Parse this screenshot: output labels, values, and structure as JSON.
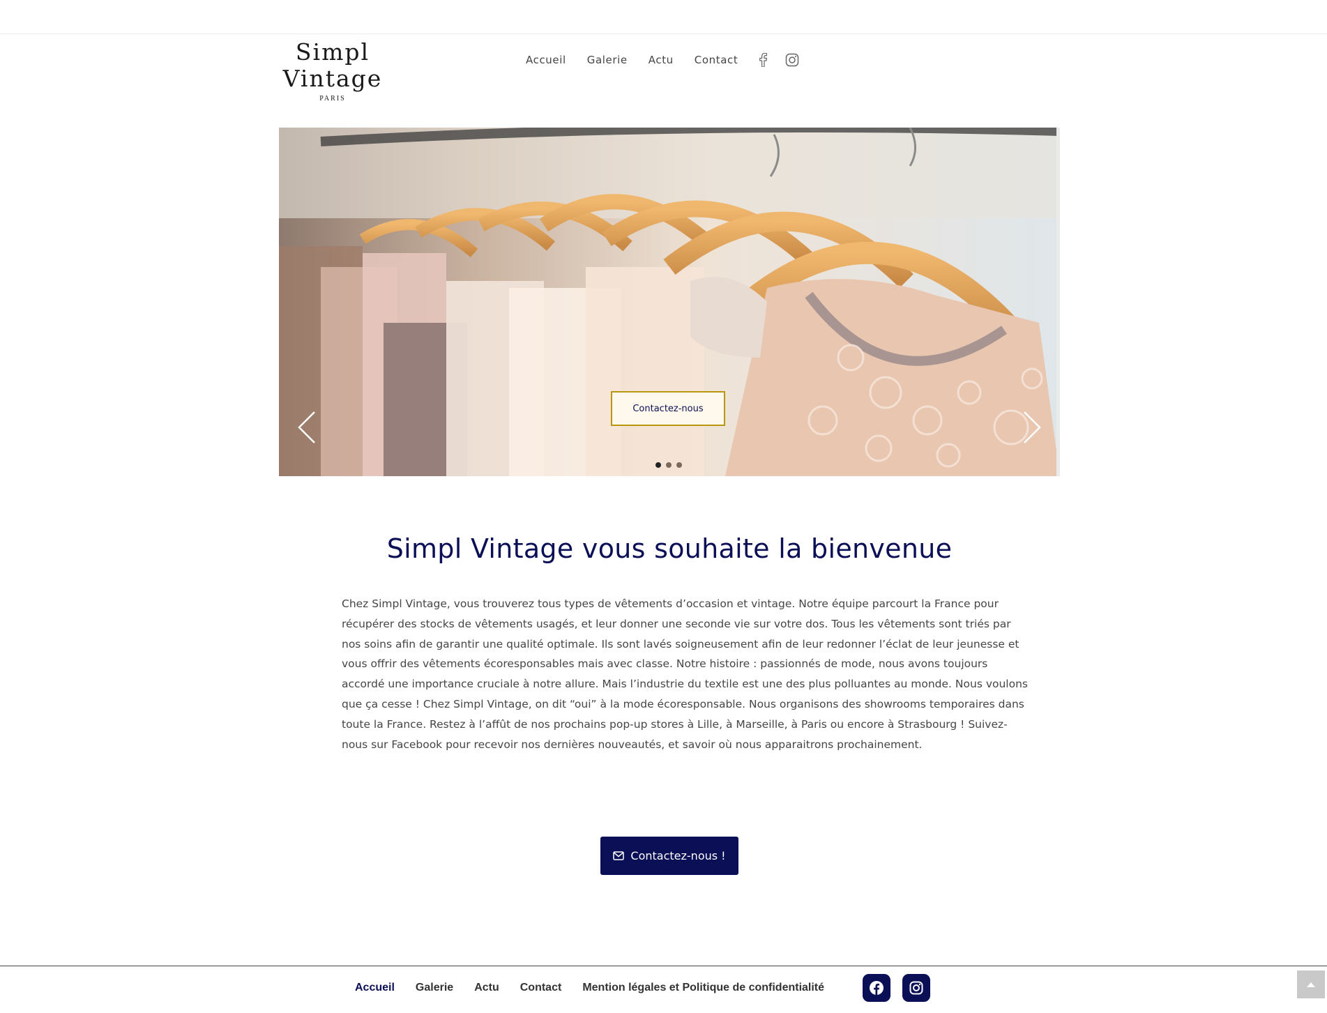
{
  "header": {
    "logo_main": "Simpl Vintage",
    "logo_sub": "PARIS",
    "nav": [
      {
        "label": "Accueil"
      },
      {
        "label": "Galerie"
      },
      {
        "label": "Actu"
      },
      {
        "label": "Contact"
      }
    ],
    "social_icons": [
      "facebook-icon",
      "instagram-icon"
    ]
  },
  "slider": {
    "cta_label": "Contactez-nous",
    "slide_count": 3,
    "active_slide": 1,
    "image_description_icon": "clothes-rack-photo"
  },
  "main": {
    "title": "Simpl Vintage vous souhaite la bienvenue",
    "paragraph": "Chez Simpl Vintage, vous trouverez tous types de vêtements d’occasion et vintage. Notre équipe parcourt la France pour récupérer des stocks de vêtements usagés, et leur donner une seconde vie sur votre dos. Tous les vêtements sont triés par nos soins afin de garantir une qualité optimale. Ils sont lavés soigneusement afin de leur redonner l’éclat de leur jeunesse et vous offrir des vêtements écoresponsables mais avec classe. Notre histoire : passionnés de mode, nous avons toujours accordé une importance cruciale à notre allure. Mais l’industrie du textile est une des plus polluantes au monde. Nous voulons que ça cesse ! Chez Simpl Vintage, on dit “oui” à la mode écoresponsable. Nous organisons des showrooms temporaires dans toute la France. Restez à l’affût de nos prochains pop-up stores à Lille, à Marseille, à Paris ou encore à Strasbourg ! Suivez-nous sur Facebook pour recevoir nos dernières nouveautés, et savoir où nous apparaitrons prochainement.",
    "cta_label": "Contactez-nous !"
  },
  "footer": {
    "nav": [
      {
        "label": "Accueil"
      },
      {
        "label": "Galerie"
      },
      {
        "label": "Actu"
      },
      {
        "label": "Contact"
      },
      {
        "label": "Mention légales et Politique de confidentialité"
      }
    ]
  },
  "colors": {
    "brand_navy": "#0b0f55",
    "cta_border_gold": "#b8960e",
    "text_gray": "#454545"
  }
}
